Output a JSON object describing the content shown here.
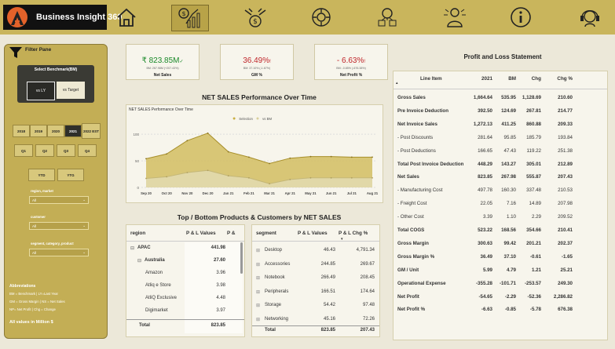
{
  "app": {
    "title": "Business Insight 360"
  },
  "nav": {
    "items": [
      {
        "icon": "home-icon",
        "active": false
      },
      {
        "icon": "finance-chart-icon",
        "active": true
      },
      {
        "icon": "sales-icon",
        "active": false
      },
      {
        "icon": "marketing-icon",
        "active": false
      },
      {
        "icon": "supply-chain-icon",
        "active": false
      },
      {
        "icon": "executive-icon",
        "active": false
      },
      {
        "icon": "info-icon",
        "active": false
      },
      {
        "icon": "support-icon",
        "active": false
      }
    ]
  },
  "filter": {
    "title": "Filter Pane",
    "benchmark_label": "Select Benchmark(BM)",
    "benchmark_options": [
      "vs LY",
      "vs Target"
    ],
    "years": [
      "2018",
      "2019",
      "2020",
      "2021",
      "2022 EST"
    ],
    "selected_year": "2021",
    "quarters": [
      "Q1",
      "Q2",
      "Q3",
      "Q4"
    ],
    "ytd": [
      "YTD",
      "YTG"
    ],
    "dropdowns": [
      {
        "label": "region, market",
        "value": "All"
      },
      {
        "label": "customer",
        "value": "All"
      },
      {
        "label": "segment, category, product",
        "value": "All"
      }
    ],
    "abbr_title": "Abbreviations",
    "abbr_lines": [
      "BM = Benchmark | LY=Last Year",
      "GM = Gross Margin | NS = Net Sales",
      "NP= Net Profit | Chg = Change"
    ],
    "values_note": "All values in Million $"
  },
  "kpis": [
    {
      "value": "₹ 823.85M",
      "sub": "BM: 267.98M (+207.43%)",
      "name": "Net Sales",
      "color": "#1a8a2a",
      "trend": "✓"
    },
    {
      "value": "36.49%",
      "sub": "BM: 37.10% (-1.67%)",
      "name": "GM %",
      "color": "#c0262b",
      "trend": "!"
    },
    {
      "value": "- 6.63%",
      "sub": "BM: -0.85% (-676.38%)",
      "name": "Net Profit %",
      "color": "#c0262b",
      "trend": "!"
    }
  ],
  "chart": {
    "section_title": "NET SALES Performance Over Time",
    "inner_title": "NET SALES Performance Over Time",
    "legend": [
      "Selection",
      "vs BM"
    ],
    "series_colors": {
      "selection": "#c9ae42",
      "bm": "#d9cf9c"
    }
  },
  "chart_data": {
    "type": "area",
    "title": "NET SALES Performance Over Time",
    "categories": [
      "Sep 20",
      "Oct 20",
      "Nov 20",
      "Dec 20",
      "Jan 21",
      "Feb 21",
      "Mar 21",
      "Apr 21",
      "May 21",
      "Jun 21",
      "Jul 21",
      "Aug 21"
    ],
    "series": [
      {
        "name": "Selection",
        "values": [
          54,
          63,
          88,
          102,
          67,
          57,
          45,
          55,
          58,
          58,
          57,
          57
        ]
      },
      {
        "name": "vs BM",
        "values": [
          17,
          20,
          28,
          32,
          22,
          18,
          7,
          15,
          18,
          18,
          18,
          18
        ]
      }
    ],
    "yticks": [
      0,
      50,
      100
    ],
    "ylim": [
      0,
      115
    ]
  },
  "tb": {
    "title": "Top / Bottom Products & Customers by NET SALES",
    "region_table": {
      "headers": [
        "region",
        "P & L Values",
        "P &"
      ],
      "rows": [
        {
          "label": "APAC",
          "value": "441.98",
          "level": 0,
          "expand": "⊟",
          "bold": true
        },
        {
          "label": "Australia",
          "value": "27.60",
          "level": 1,
          "expand": "⊟",
          "bold": true
        },
        {
          "label": "Amazon",
          "value": "3.96",
          "level": 2,
          "expand": "",
          "bold": false
        },
        {
          "label": "Atliq e Store",
          "value": "3.98",
          "level": 2,
          "expand": "",
          "bold": false
        },
        {
          "label": "AtliQ Exclusive",
          "value": "4.48",
          "level": 2,
          "expand": "",
          "bold": false
        },
        {
          "label": "Digimarket",
          "value": "3.97",
          "level": 2,
          "expand": "",
          "bold": false
        }
      ],
      "total": {
        "label": "Total",
        "value": "823.85"
      }
    },
    "segment_table": {
      "headers": [
        "segment",
        "P & L Values",
        "P & L Chg %"
      ],
      "rows": [
        {
          "label": "Desktop",
          "value": "46.43",
          "chg": "4,791.34"
        },
        {
          "label": "Accessories",
          "value": "244.85",
          "chg": "269.67"
        },
        {
          "label": "Notebook",
          "value": "266.49",
          "chg": "208.45"
        },
        {
          "label": "Peripherals",
          "value": "166.51",
          "chg": "174.64"
        },
        {
          "label": "Storage",
          "value": "54.42",
          "chg": "97.48"
        },
        {
          "label": "Networking",
          "value": "45.16",
          "chg": "72.26"
        }
      ],
      "total": {
        "label": "Total",
        "value": "823.85",
        "chg": "207.43"
      }
    }
  },
  "pl": {
    "title": "Profit and Loss Statement",
    "headers": [
      "Line Item",
      "2021",
      "BM",
      "Chg",
      "Chg %"
    ],
    "rows": [
      [
        "Gross Sales",
        "1,664.64",
        "535.95",
        "1,128.69",
        "210.60"
      ],
      [
        "Pre Invoice Deduction",
        "392.50",
        "124.69",
        "267.81",
        "214.77"
      ],
      [
        "Net Invoice Sales",
        "1,272.13",
        "411.25",
        "860.88",
        "209.33"
      ],
      [
        "- Post Discounts",
        "281.64",
        "95.85",
        "185.79",
        "193.84"
      ],
      [
        "- Post Deductions",
        "166.65",
        "47.43",
        "119.22",
        "251.38"
      ],
      [
        "Total Post Invoice Deduction",
        "448.29",
        "143.27",
        "305.01",
        "212.89"
      ],
      [
        "Net Sales",
        "823.85",
        "267.98",
        "555.87",
        "207.43"
      ],
      [
        "- Manufacturing Cost",
        "497.78",
        "160.30",
        "337.48",
        "210.53"
      ],
      [
        "- Freight Cost",
        "22.05",
        "7.16",
        "14.89",
        "207.98"
      ],
      [
        "- Other Cost",
        "3.39",
        "1.10",
        "2.29",
        "209.52"
      ],
      [
        "Total COGS",
        "523.22",
        "168.56",
        "354.66",
        "210.41"
      ],
      [
        "Gross Margin",
        "300.63",
        "99.42",
        "201.21",
        "202.37"
      ],
      [
        "Gross Margin %",
        "36.49",
        "37.10",
        "-0.61",
        "-1.65"
      ],
      [
        "GM / Unit",
        "5.99",
        "4.79",
        "1.21",
        "25.21"
      ],
      [
        "Operational Expense",
        "-355.28",
        "-101.71",
        "-253.57",
        "249.30"
      ],
      [
        "Net Profit",
        "-54.65",
        "-2.29",
        "-52.36",
        "2,286.82"
      ],
      [
        "Net Profit %",
        "-6.63",
        "-0.85",
        "-5.78",
        "676.38"
      ]
    ]
  }
}
